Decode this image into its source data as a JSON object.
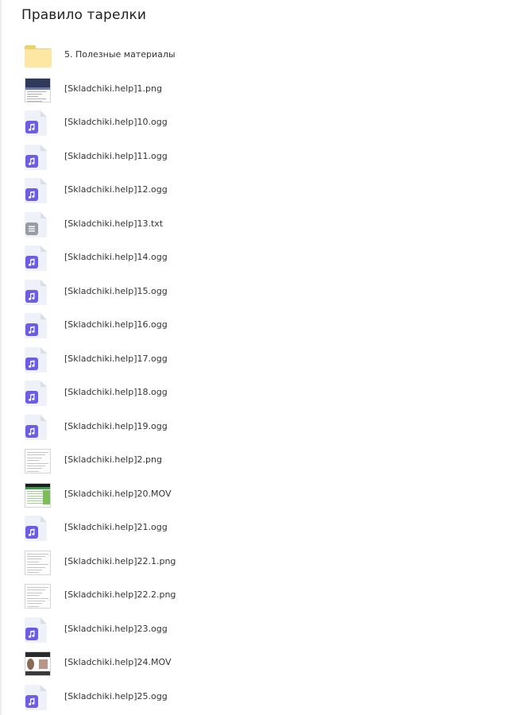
{
  "title": "Правило тарелки",
  "files": [
    {
      "name": "5. Полезные материалы",
      "kind": "folder",
      "icon": "folder-icon"
    },
    {
      "name": "[Skladchiki.help]1.png",
      "kind": "image-screen",
      "icon": "image-thumbnail"
    },
    {
      "name": "[Skladchiki.help]10.ogg",
      "kind": "audio",
      "icon": "audio-file-icon"
    },
    {
      "name": "[Skladchiki.help]11.ogg",
      "kind": "audio",
      "icon": "audio-file-icon"
    },
    {
      "name": "[Skladchiki.help]12.ogg",
      "kind": "audio",
      "icon": "audio-file-icon"
    },
    {
      "name": "[Skladchiki.help]13.txt",
      "kind": "text",
      "icon": "text-file-icon"
    },
    {
      "name": "[Skladchiki.help]14.ogg",
      "kind": "audio",
      "icon": "audio-file-icon"
    },
    {
      "name": "[Skladchiki.help]15.ogg",
      "kind": "audio",
      "icon": "audio-file-icon"
    },
    {
      "name": "[Skladchiki.help]16.ogg",
      "kind": "audio",
      "icon": "audio-file-icon"
    },
    {
      "name": "[Skladchiki.help]17.ogg",
      "kind": "audio",
      "icon": "audio-file-icon"
    },
    {
      "name": "[Skladchiki.help]18.ogg",
      "kind": "audio",
      "icon": "audio-file-icon"
    },
    {
      "name": "[Skladchiki.help]19.ogg",
      "kind": "audio",
      "icon": "audio-file-icon"
    },
    {
      "name": "[Skladchiki.help]2.png",
      "kind": "image-doc",
      "icon": "image-thumbnail"
    },
    {
      "name": "[Skladchiki.help]20.MOV",
      "kind": "video-green",
      "icon": "video-thumbnail"
    },
    {
      "name": "[Skladchiki.help]21.ogg",
      "kind": "audio",
      "icon": "audio-file-icon"
    },
    {
      "name": "[Skladchiki.help]22.1.png",
      "kind": "image-doc",
      "icon": "image-thumbnail"
    },
    {
      "name": "[Skladchiki.help]22.2.png",
      "kind": "image-doc",
      "icon": "image-thumbnail"
    },
    {
      "name": "[Skladchiki.help]23.ogg",
      "kind": "audio",
      "icon": "audio-file-icon"
    },
    {
      "name": "[Skladchiki.help]24.MOV",
      "kind": "video-photo",
      "icon": "video-thumbnail"
    },
    {
      "name": "[Skladchiki.help]25.ogg",
      "kind": "audio",
      "icon": "audio-file-icon"
    }
  ],
  "colors": {
    "audio_badge": "#6c5ce7",
    "text_badge": "#9a9ca3",
    "folder": "#fde7a3"
  }
}
